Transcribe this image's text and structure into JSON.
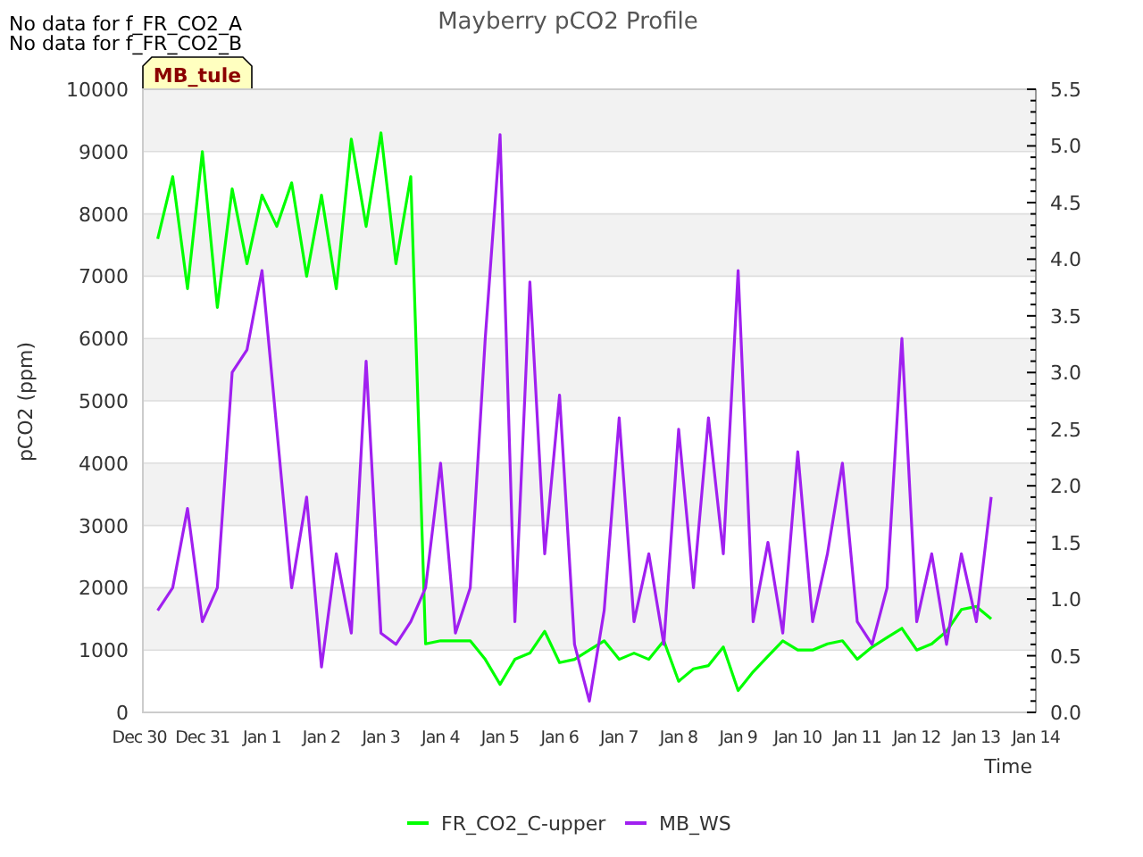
{
  "notes": [
    "No data for f_FR_CO2_A",
    "No data for f_FR_CO2_B"
  ],
  "title": "Mayberry pCO2 Profile",
  "badge": "MB_tule",
  "chart_data": {
    "type": "line",
    "xlabel": "Time",
    "ylabel": "pCO2 (ppm)",
    "categories": [
      "Dec 30",
      null,
      null,
      null,
      "Dec 31",
      null,
      null,
      null,
      "Jan 1",
      null,
      null,
      null,
      "Jan 2",
      null,
      null,
      null,
      "Jan 3",
      null,
      null,
      null,
      "Jan 4",
      null,
      null,
      null,
      "Jan 5",
      null,
      null,
      null,
      "Jan 6",
      null,
      null,
      null,
      "Jan 7",
      null,
      null,
      null,
      "Jan 8",
      null,
      null,
      null,
      "Jan 9",
      null,
      null,
      null,
      "Jan 10",
      null,
      null,
      null,
      "Jan 11",
      null,
      null,
      null,
      "Jan 12",
      null,
      null,
      null,
      "Jan 13",
      null,
      null,
      null,
      "Jan 14"
    ],
    "grid": true,
    "legend": "bottom",
    "ylim": [
      0,
      10000
    ],
    "yticks": [
      0,
      1000,
      2000,
      3000,
      4000,
      5000,
      6000,
      7000,
      8000,
      9000,
      10000
    ],
    "y2lim": [
      0,
      5.5
    ],
    "y2ticks": [
      {
        "value": 0,
        "label": "0.0"
      },
      {
        "value": 0.5,
        "label": "0.5"
      },
      {
        "value": 1,
        "label": "1.0"
      },
      {
        "value": 1.5,
        "label": "1.5"
      },
      {
        "value": 2,
        "label": "2.0"
      },
      {
        "value": 2.5,
        "label": "2.5"
      },
      {
        "value": 3,
        "label": "3.0"
      },
      {
        "value": 3.5,
        "label": "3.5"
      },
      {
        "value": 4,
        "label": "4.0"
      },
      {
        "value": 4.5,
        "label": "4.5"
      },
      {
        "value": 5,
        "label": "5.0"
      },
      {
        "value": 5.5,
        "label": "5.5"
      }
    ],
    "series": [
      {
        "name": "FR_CO2_C-upper",
        "color": "#00ff00",
        "values": [
          null,
          7600,
          8600,
          6800,
          9000,
          6500,
          8400,
          7200,
          8300,
          7800,
          8500,
          7000,
          8300,
          6800,
          9200,
          7800,
          9300,
          7200,
          8600,
          1100,
          1150,
          1150,
          1150,
          850,
          450,
          850,
          950,
          1300,
          800,
          850,
          1000,
          1150,
          850,
          950,
          850,
          1150,
          500,
          700,
          750,
          1050,
          350,
          650,
          900,
          1150,
          1000,
          1000,
          1100,
          1150,
          850,
          1050,
          1200,
          1350,
          1000,
          1100,
          1300,
          1650,
          1700,
          1500,
          null,
          null,
          null
        ]
      },
      {
        "name": "MB_WS",
        "color": "#a020f0",
        "axis": "y2",
        "values": [
          null,
          0.9,
          1.1,
          1.8,
          0.8,
          1.1,
          3.0,
          3.2,
          3.9,
          2.5,
          1.1,
          1.9,
          0.4,
          1.4,
          0.7,
          3.1,
          0.7,
          0.6,
          0.8,
          1.1,
          2.2,
          0.7,
          1.1,
          3.3,
          5.1,
          0.8,
          3.8,
          1.4,
          2.8,
          0.6,
          0.1,
          0.9,
          2.6,
          0.8,
          1.4,
          0.6,
          2.5,
          1.1,
          2.6,
          1.4,
          3.9,
          0.8,
          1.5,
          0.7,
          2.3,
          0.8,
          1.4,
          2.2,
          0.8,
          0.6,
          1.1,
          3.3,
          0.8,
          1.4,
          0.6,
          1.4,
          0.8,
          1.9,
          null,
          null,
          null
        ]
      }
    ]
  }
}
